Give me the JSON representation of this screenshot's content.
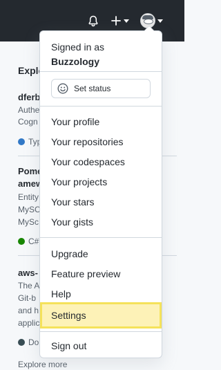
{
  "header": {
    "icons": [
      "bell-icon",
      "plus-icon",
      "avatar-icon"
    ]
  },
  "background": {
    "heading": "Explo",
    "repos": [
      {
        "title": "dferb",
        "desc": [
          "Authe",
          "Cogn"
        ],
        "lang": "Typ",
        "lang_color": "#3178c6"
      },
      {
        "title": "Pome",
        "subtitle": "amew",
        "desc": [
          "Entity",
          "MySC",
          "MySc"
        ],
        "lang": "C#",
        "lang_color": "#178600"
      },
      {
        "title": "aws-",
        "desc": [
          "The A",
          "Git-b",
          "and h",
          "applic"
        ],
        "lang": "Do",
        "lang_color": "#384d54"
      }
    ],
    "footer_text": "Explore more"
  },
  "dropdown": {
    "signed_in_as": "Signed in as",
    "username": "Buzzology",
    "set_status": "Set status",
    "group1": [
      "Your profile",
      "Your repositories",
      "Your codespaces",
      "Your projects",
      "Your stars",
      "Your gists"
    ],
    "group2": [
      "Upgrade",
      "Feature preview",
      "Help",
      "Settings"
    ],
    "sign_out": "Sign out",
    "highlighted": "Settings"
  }
}
